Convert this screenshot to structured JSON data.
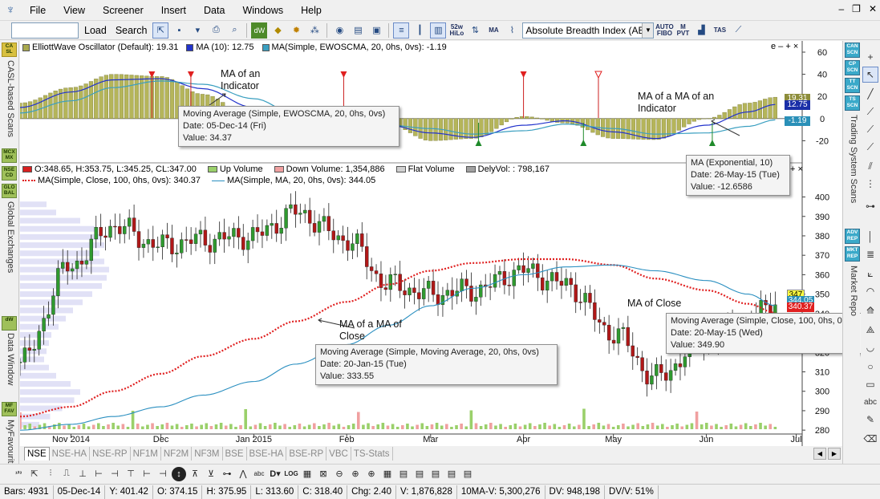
{
  "menu": {
    "items": [
      "File",
      "View",
      "Screener",
      "Insert",
      "Data",
      "Windows",
      "Help"
    ]
  },
  "toolbar": {
    "symbol_value": "",
    "load_label": "Load",
    "search_label": "Search",
    "indicator_select": "Absolute Breadth Index (ABI",
    "icons": {
      "wk52": "52w HiLo",
      "ma": "MA",
      "auto_fibo": "AUTO FIBO",
      "mpvt": "M PVT",
      "tas": "TAS"
    }
  },
  "left_panel": {
    "labels": [
      "CASL-based Scans",
      "Global Exchanges",
      "Data Window",
      "MyFavourit"
    ],
    "buttons": [
      "CA SL",
      "MCX MX",
      "NSE CD",
      "GLO BAL",
      "dW",
      "MF FAV"
    ]
  },
  "right_panel": {
    "labels": [
      "Trading System Scans",
      "Market Repo"
    ],
    "buttons": [
      "CAN SCN",
      "CP SCN",
      "TT SCN",
      "TS SCN",
      "ADV REP",
      "MKT REP",
      "SEC REP"
    ]
  },
  "oscillator": {
    "legend": [
      "ElliottWave Oscillator (Default): 19.31",
      "MA (10): 12.75",
      "MA(Simple, EWOSCMA, 20, 0hs, 0vs): -1.19"
    ],
    "legend_colors": [
      "#a9a94e",
      "#2233cc",
      "#3a9fc0"
    ],
    "controls": "e – + ×",
    "y_ticks": [
      "60",
      "40",
      "20",
      "0",
      "-20",
      "-40"
    ],
    "badges": [
      "19.31",
      "12.75",
      "-1.19"
    ],
    "badge_colors": [
      "#8d8d3a",
      "#1a2fa8",
      "#2a90b8"
    ],
    "annotations": [
      "MA of an Indicator",
      "MA of a MA of an Indicator"
    ]
  },
  "price": {
    "legend_row1": [
      "O:348.65, H:353.75, L:345.25, CL:347.00",
      "Up Volume",
      "Down Volume: 1,354,886",
      "Flat Volume",
      "DelyVol: : 798,167"
    ],
    "legend_row1_colors": [
      "#d92020",
      "#9ad06a",
      "#f0a0a0",
      "#d0d0d0",
      "#a0a0a0"
    ],
    "legend_row2": [
      "MA(Simple, Close, 100, 0hs, 0vs): 340.37",
      "MA(Simple, MA, 20, 0hs, 0vs): 344.05"
    ],
    "y_ticks": [
      "400",
      "390",
      "380",
      "370",
      "360",
      "350",
      "340",
      "330",
      "320",
      "310",
      "300",
      "290",
      "280"
    ],
    "badges": [
      "347",
      "344.05",
      "340.37"
    ],
    "annotations": [
      "MA of Close",
      "MA of a MA of Close"
    ]
  },
  "x_axis": [
    "Nov 2014",
    "Dec",
    "Jan 2015",
    "Feb",
    "Mar",
    "Apr",
    "May",
    "Jun",
    "Jul"
  ],
  "tooltips": [
    {
      "title": "Moving Average (Simple, EWOSCMA, 20, 0hs, 0vs)",
      "date": "Date: 05-Dec-14 (Fri)",
      "value": "Value: 34.37"
    },
    {
      "title": "MA (Exponential, 10)",
      "date": "Date: 26-May-15 (Tue)",
      "value": "Value: -12.6586"
    },
    {
      "title": "Moving Average (Simple, Close, 100, 0hs, 0vs)",
      "date": "Date: 20-May-15 (Wed)",
      "value": "Value: 349.90"
    },
    {
      "title": "Moving Average (Simple, Moving Average, 20, 0hs, 0vs)",
      "date": "Date: 20-Jan-15 (Tue)",
      "value": "Value: 333.55"
    }
  ],
  "tabs": [
    "NSE",
    "NSE-HA",
    "NSE-RP",
    "NF1M",
    "NF2M",
    "NF3M",
    "BSE",
    "BSE-HA",
    "BSE-RP",
    "VBC",
    "TS-Stats"
  ],
  "bottom_toolbar": {
    "log_label": "LOG"
  },
  "status": [
    "Bars: 4931",
    "05-Dec-14",
    "Y: 401.42",
    "O: 374.15",
    "H: 375.95",
    "L: 313.60",
    "C: 318.40",
    "Chg: 2.40",
    "V: 1,876,828",
    "10MA-V: 5,300,276",
    "DV: 948,198",
    "DV/V: 51%"
  ],
  "chart_data": [
    {
      "type": "bar",
      "title": "ElliottWave Oscillator (Default)",
      "ylim": [
        -40,
        60
      ],
      "y_ticks": [
        60,
        40,
        20,
        0,
        -20,
        -40
      ],
      "x": [
        "2014-10-15",
        "2014-11-01",
        "2014-11-15",
        "2014-12-01",
        "2014-12-15",
        "2015-01-01",
        "2015-01-15",
        "2015-02-01",
        "2015-02-15",
        "2015-03-01",
        "2015-03-15",
        "2015-04-01",
        "2015-04-15",
        "2015-05-01",
        "2015-05-15",
        "2015-06-01",
        "2015-06-15",
        "2015-06-24"
      ],
      "values": [
        14,
        28,
        40,
        38,
        22,
        0,
        -10,
        -7,
        -5,
        -20,
        -18,
        2,
        -4,
        -18,
        -19,
        0,
        14,
        19.31
      ],
      "series": [
        {
          "name": "MA (10)",
          "values": [
            10,
            24,
            35,
            36,
            27,
            10,
            -3,
            -8,
            -6,
            -13,
            -17,
            -6,
            -2,
            -12,
            -18,
            -6,
            6,
            12.75
          ]
        },
        {
          "name": "MA(Simple, EWOSCMA, 20, 0hs, 0vs)",
          "values": [
            5,
            16,
            28,
            34,
            31,
            18,
            4,
            -4,
            -6,
            -9,
            -14,
            -11,
            -5,
            -9,
            -14,
            -13,
            -7,
            -1.19
          ]
        }
      ]
    },
    {
      "type": "line",
      "title": "",
      "ylim": [
        278,
        406
      ],
      "y_ticks": [
        400,
        390,
        380,
        370,
        360,
        350,
        340,
        330,
        320,
        310,
        300,
        290,
        280
      ],
      "x": [
        "2014-10-15",
        "2014-11-01",
        "2014-11-15",
        "2014-12-01",
        "2014-12-15",
        "2015-01-01",
        "2015-01-15",
        "2015-02-01",
        "2015-02-15",
        "2015-03-01",
        "2015-03-15",
        "2015-04-01",
        "2015-04-15",
        "2015-05-01",
        "2015-05-15",
        "2015-06-01",
        "2015-06-15",
        "2015-06-24"
      ],
      "series": [
        {
          "name": "Close",
          "values": [
            315,
            365,
            385,
            375,
            378,
            380,
            392,
            378,
            355,
            350,
            352,
            362,
            355,
            330,
            307,
            327,
            335,
            347
          ]
        },
        {
          "name": "MA(Simple, Close, 100, 0hs, 0vs)",
          "values": [
            287,
            292,
            300,
            309,
            318,
            327,
            336,
            346,
            355,
            362,
            366,
            368,
            368,
            365,
            358,
            352,
            345,
            340.37
          ]
        },
        {
          "name": "MA(Simple, MA, 20, 0hs, 0vs)",
          "values": [
            280,
            283,
            287,
            292,
            298,
            305,
            314,
            324,
            334,
            344,
            353,
            360,
            364,
            365,
            362,
            357,
            350,
            344.05
          ]
        }
      ]
    }
  ]
}
